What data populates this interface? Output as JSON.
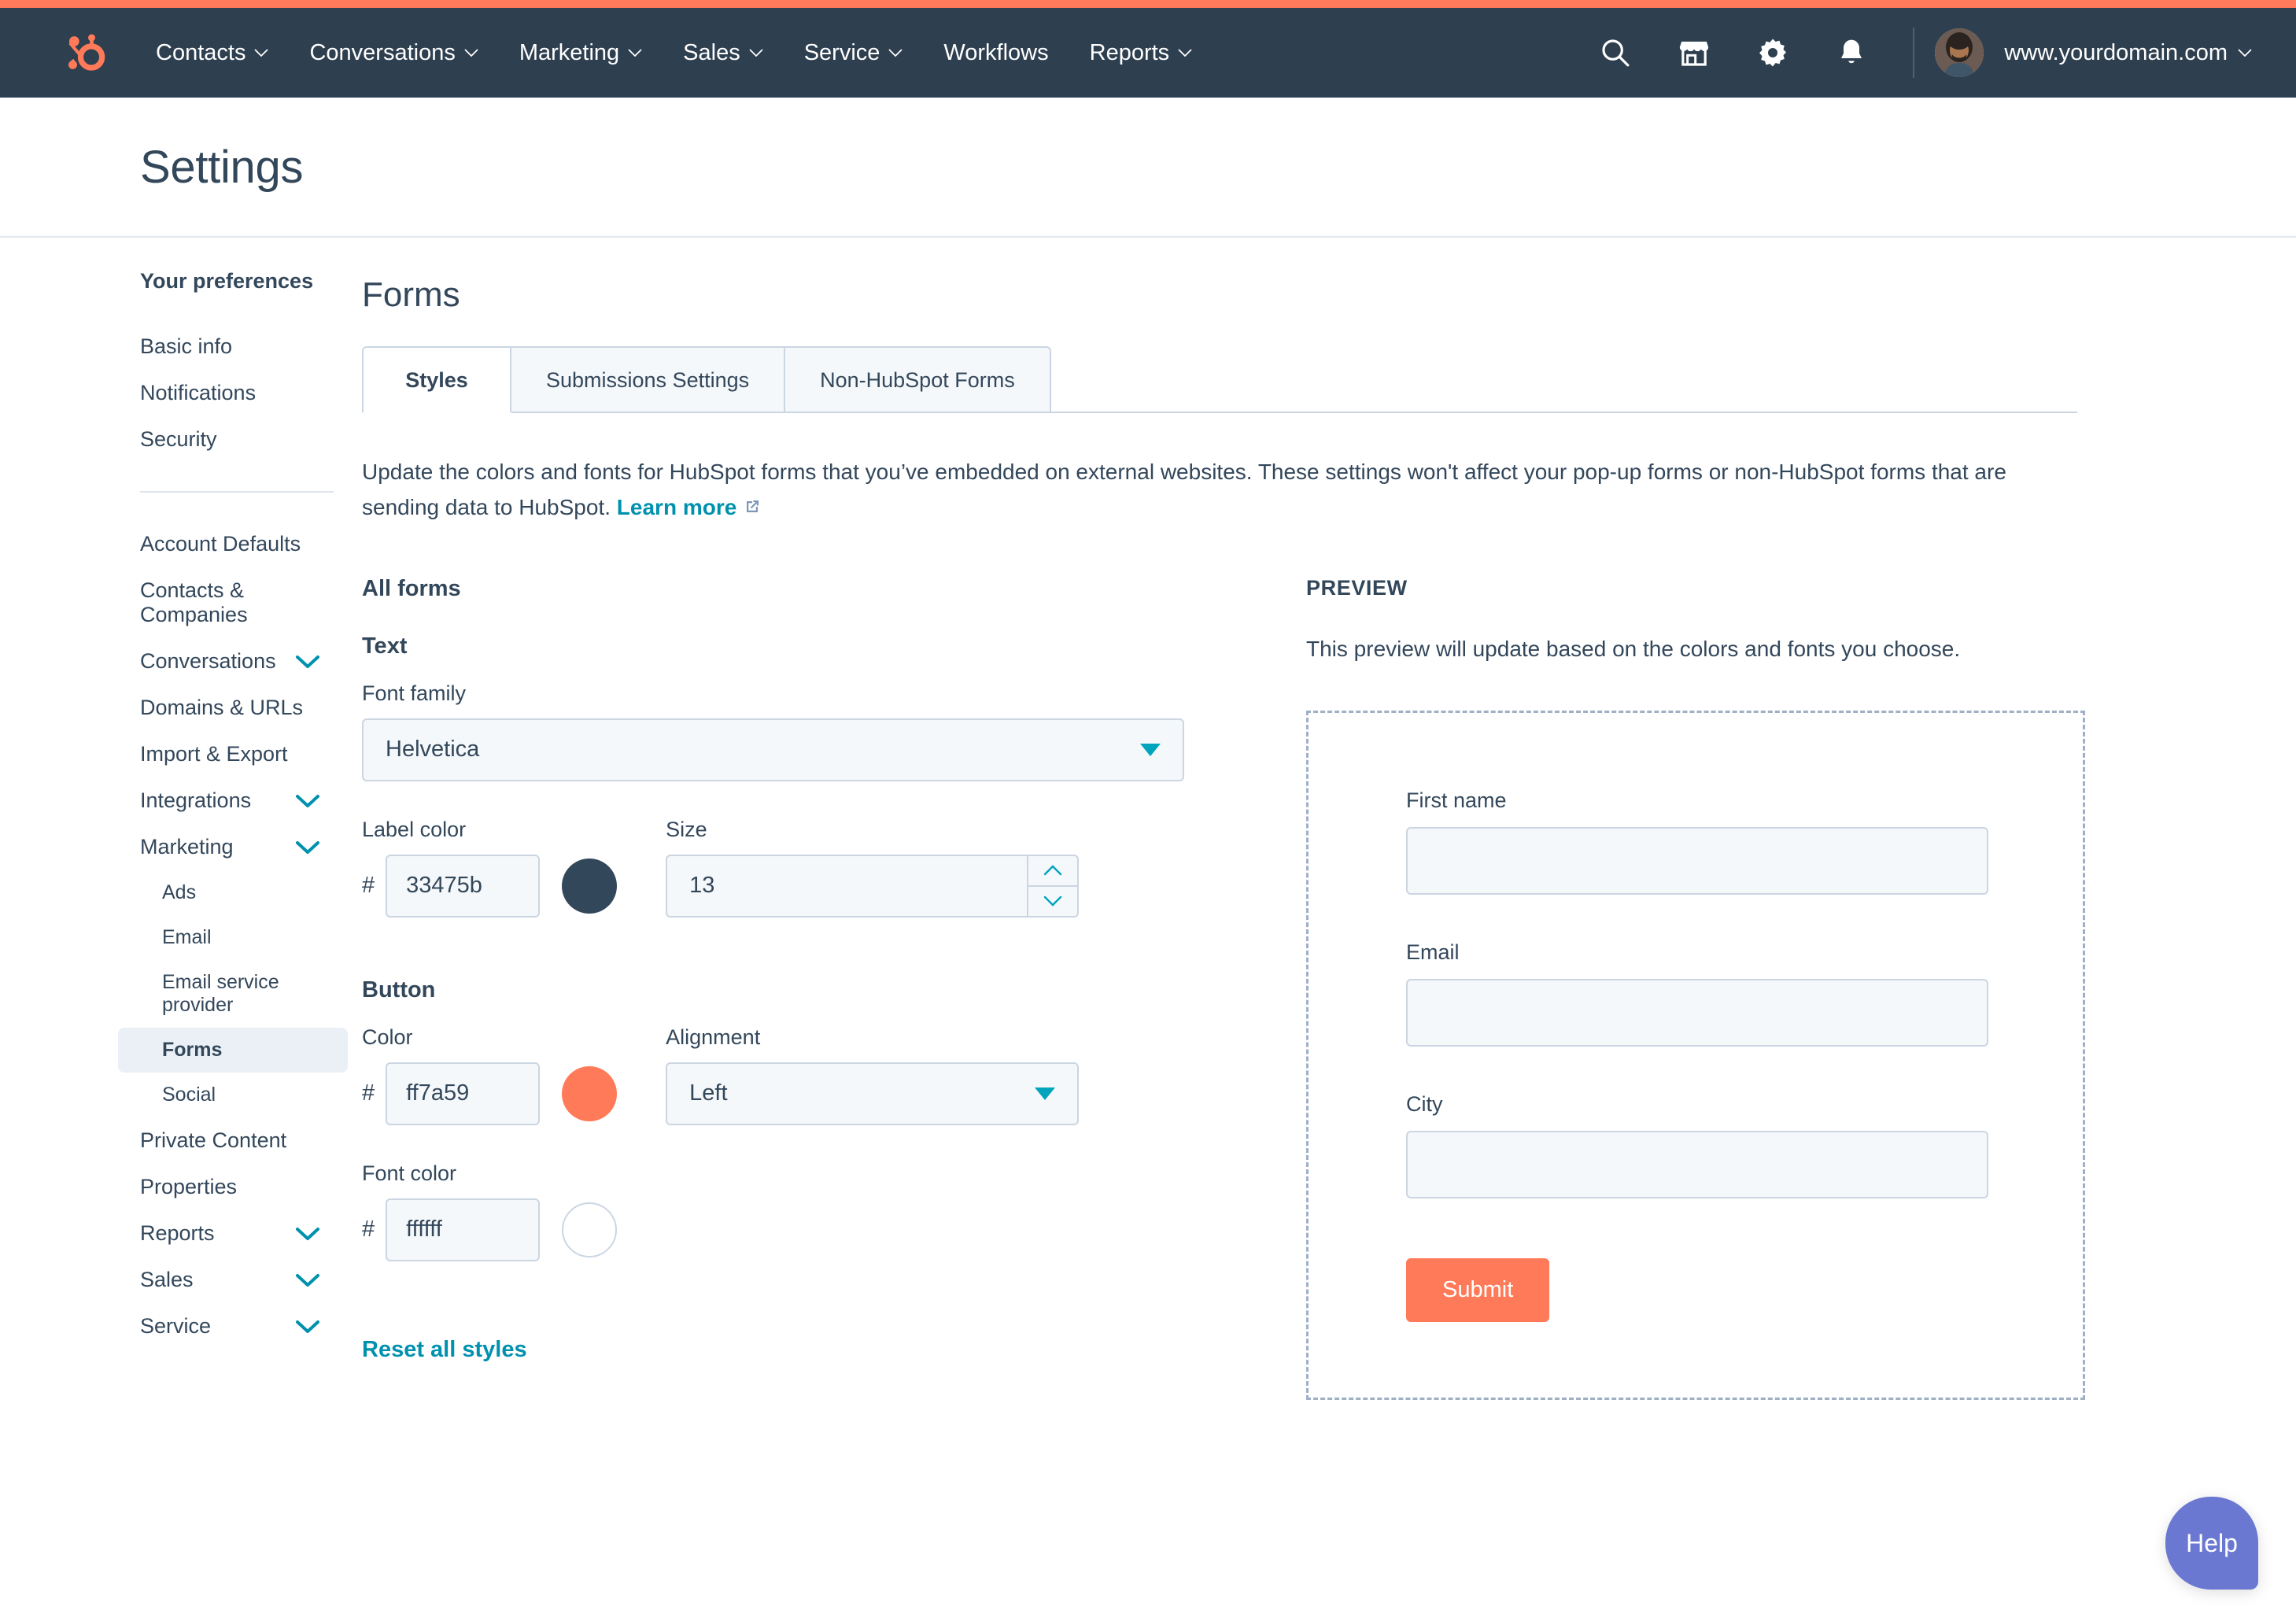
{
  "colors": {
    "brand_orange": "#ff7a59",
    "nav_bg": "#2e3f50",
    "text_dark": "#33475b",
    "link_teal": "#0091ae",
    "caret_teal": "#00a4bd",
    "help_purple": "#6a78d1"
  },
  "navbar": {
    "logo_name": "hubspot-sprocket-logo",
    "links": [
      {
        "label": "Contacts",
        "has_caret": true
      },
      {
        "label": "Conversations",
        "has_caret": true
      },
      {
        "label": "Marketing",
        "has_caret": true
      },
      {
        "label": "Sales",
        "has_caret": true
      },
      {
        "label": "Service",
        "has_caret": true
      },
      {
        "label": "Workflows",
        "has_caret": false
      },
      {
        "label": "Reports",
        "has_caret": true
      }
    ],
    "icons": [
      "search-icon",
      "marketplace-icon",
      "gear-icon",
      "bell-icon"
    ],
    "account_name": "www.yourdomain.com"
  },
  "page": {
    "title": "Settings"
  },
  "sidebar": {
    "heading": "Your preferences",
    "prefs": [
      {
        "label": "Basic info",
        "caret": false
      },
      {
        "label": "Notifications",
        "caret": false
      },
      {
        "label": "Security",
        "caret": false
      }
    ],
    "items": [
      {
        "label": "Account Defaults",
        "caret": false,
        "sub": false,
        "active": false
      },
      {
        "label": "Contacts & Companies",
        "caret": false,
        "sub": false,
        "active": false
      },
      {
        "label": "Conversations",
        "caret": true,
        "sub": false,
        "active": false
      },
      {
        "label": "Domains & URLs",
        "caret": false,
        "sub": false,
        "active": false
      },
      {
        "label": "Import & Export",
        "caret": false,
        "sub": false,
        "active": false
      },
      {
        "label": "Integrations",
        "caret": true,
        "sub": false,
        "active": false
      },
      {
        "label": "Marketing",
        "caret": true,
        "sub": false,
        "active": false
      },
      {
        "label": "Ads",
        "caret": false,
        "sub": true,
        "active": false
      },
      {
        "label": "Email",
        "caret": false,
        "sub": true,
        "active": false
      },
      {
        "label": "Email service provider",
        "caret": false,
        "sub": true,
        "active": false
      },
      {
        "label": "Forms",
        "caret": false,
        "sub": true,
        "active": true
      },
      {
        "label": "Social",
        "caret": false,
        "sub": true,
        "active": false
      },
      {
        "label": "Private Content",
        "caret": false,
        "sub": false,
        "active": false
      },
      {
        "label": "Properties",
        "caret": false,
        "sub": false,
        "active": false
      },
      {
        "label": "Reports",
        "caret": true,
        "sub": false,
        "active": false
      },
      {
        "label": "Sales",
        "caret": true,
        "sub": false,
        "active": false
      },
      {
        "label": "Service",
        "caret": true,
        "sub": false,
        "active": false
      }
    ]
  },
  "main": {
    "heading": "Forms",
    "tabs": [
      {
        "label": "Styles",
        "active": true
      },
      {
        "label": "Submissions Settings",
        "active": false
      },
      {
        "label": "Non-HubSpot Forms",
        "active": false
      }
    ],
    "description_part1": "Update the colors and fonts for HubSpot forms that you’ve embedded on external websites. These settings won't affect your pop-up forms or non-HubSpot forms that are sending data to HubSpot. ",
    "learn_more_label": "Learn more",
    "all_forms_title": "All forms",
    "text_section": {
      "title": "Text",
      "font_family_label": "Font family",
      "font_family_value": "Helvetica",
      "label_color_label": "Label color",
      "label_color_value": "33475b",
      "label_color_swatch": "#33475b",
      "size_label": "Size",
      "size_value": "13"
    },
    "button_section": {
      "title": "Button",
      "color_label": "Color",
      "color_value": "ff7a59",
      "color_swatch": "#ff7a59",
      "alignment_label": "Alignment",
      "alignment_value": "Left",
      "font_color_label": "Font color",
      "font_color_value": "ffffff",
      "font_color_swatch": "#ffffff"
    },
    "reset_label": "Reset all styles"
  },
  "preview": {
    "heading": "PREVIEW",
    "description": "This preview will update based on the colors and fonts you choose.",
    "fields": [
      {
        "label": "First name",
        "value": ""
      },
      {
        "label": "Email",
        "value": ""
      },
      {
        "label": "City",
        "value": ""
      }
    ],
    "submit_label": "Submit"
  },
  "help": {
    "label": "Help"
  }
}
